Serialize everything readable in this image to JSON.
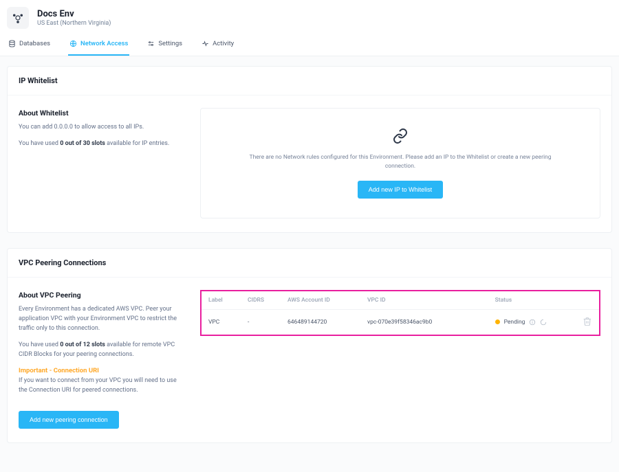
{
  "env": {
    "name": "Docs Env",
    "region": "US East (Northern Virginia)"
  },
  "tabs": {
    "databases": "Databases",
    "network": "Network Access",
    "settings": "Settings",
    "activity": "Activity"
  },
  "whitelist": {
    "title": "IP Whitelist",
    "about_heading": "About Whitelist",
    "about_line1": "You can add 0.0.0.0 to allow access to all IPs.",
    "about_used_prefix": "You have used ",
    "about_slots": "0 out of 30 slots",
    "about_used_suffix": " available for IP entries.",
    "empty_text": "There are no Network rules configured for this Environment. Please add an IP to the Whitelist or create a new peering connection.",
    "add_button": "Add new IP to Whitelist"
  },
  "vpc": {
    "title": "VPC Peering Connections",
    "about_heading": "About VPC Peering",
    "about_p1": "Every Environment has a dedicated AWS VPC. Peer your application VPC with your Environment VPC to restrict the traffic only to this connection.",
    "slots_prefix": "You have used ",
    "slots_bold": "0 out of 12 slots",
    "slots_suffix": " available for remote VPC CIDR Blocks for your peering connections.",
    "warn_heading": "Important - Connection URI",
    "warn_text": "If you want to connect from your VPC you will need to use the Connection URI for peered connections.",
    "add_button": "Add new peering connection",
    "table": {
      "headers": {
        "label": "Label",
        "cidrs": "CIDRS",
        "account": "AWS Account ID",
        "vpcid": "VPC ID",
        "status": "Status"
      },
      "row": {
        "label": "VPC",
        "cidrs": "-",
        "account": "646489144720",
        "vpcid": "vpc-070e39f58346ac9b0",
        "status": "Pending"
      }
    }
  }
}
